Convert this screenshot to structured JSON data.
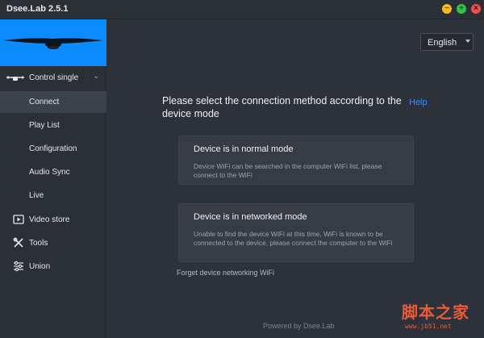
{
  "window": {
    "title": "Dsee.Lab 2.5.1",
    "buttons": {
      "minimize": "−",
      "maximize": "+",
      "close": "×"
    }
  },
  "sidebar": {
    "group": {
      "label": "Control single",
      "icon": "drone-icon"
    },
    "sub_items": [
      {
        "label": "Connect",
        "active": true
      },
      {
        "label": "Play List",
        "active": false
      },
      {
        "label": "Configuration",
        "active": false
      },
      {
        "label": "Audio Sync",
        "active": false
      },
      {
        "label": "Live",
        "active": false
      }
    ],
    "items": [
      {
        "label": "Video store",
        "icon": "video-icon"
      },
      {
        "label": "Tools",
        "icon": "tools-icon"
      },
      {
        "label": "Union",
        "icon": "sliders-icon"
      }
    ]
  },
  "language": {
    "selected": "English"
  },
  "main": {
    "heading": "Please select the connection method according to the device mode",
    "help_link": "Help",
    "cards": [
      {
        "title": "Device is in normal mode",
        "description": "Device WiFi can be searched in the computer WiFi list, please connect to the WiFi"
      },
      {
        "title": "Device is in networked mode",
        "description": "Unable to find the device WiFi at this time, WiFi is known to be connected to the device, please connect the computer to the WiFi"
      }
    ],
    "forget_link": "Forget device networking WiFi"
  },
  "footer": {
    "text": "Powered by Dsee.Lab"
  },
  "watermark": {
    "main": "脚本之家",
    "sub": "www.jb51.net"
  },
  "colors": {
    "accent": "#0a8cff",
    "link": "#3d8bff",
    "background": "#2d323a",
    "sidebar": "#2b2f36",
    "card": "#363b44"
  }
}
